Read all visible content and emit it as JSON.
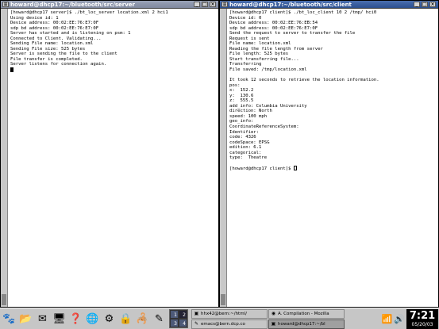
{
  "left_terminal": {
    "title": "howard@dhcp17:~/bluetooth/src/server",
    "lines": [
      "[howard@dhcp17 server]$ ./bt_loc_server location.xml 2 hci1",
      "Using device id: 1",
      "Device address: 00:02:EE:76:E7:0F",
      "sdp bd address: 00:02:EE:76:E7:0F",
      "Server has started and is listening on psm: 1",
      "Connected to Client. Validating...",
      "Sending File name: location.xml",
      "Sending File size: 525 bytes",
      "Server is sending the file to the client",
      "File transfer is completed.",
      "Server listens for connection again."
    ]
  },
  "right_terminal": {
    "title": "howard@dhcp17:~/bluetooth/src/client",
    "lines": [
      "[howard@dhcp17 client]$ ./bt_loc_client 10 2 /tmp/ hci0",
      "Device id: 0",
      "Device address: 00:02:EE:76:EB:54",
      "sdp bd address: 00:02:EE:76:E7:0F",
      "Send the request to server to transfer the file",
      "Request is sent",
      "File name: location.xml",
      "Reading the file length from server",
      "File length: 525 bytes",
      "Start transferring file...",
      "Transferring",
      "File saved: /tmp/location.xml",
      "",
      "It took 12 seconds to retrieve the location information.",
      "pos:",
      "x:  152.2",
      "y:  130.6",
      "z:  555.5",
      "add_info: Columbia University",
      "direction: North",
      "speed: 100 mph",
      "geo_info:",
      "CoordinateReferenceSystem:",
      "Identifier:",
      "code: 4326",
      "codeSpace: EPSG",
      "edition: 6.1",
      "categorical:",
      "type:  Theatre",
      "",
      "[howard@dhcp17 client]$ "
    ]
  },
  "taskbar": {
    "pager": [
      "1",
      "2",
      "3",
      "4"
    ],
    "tasks": [
      {
        "label": "hhx42@bern:~/html/",
        "icon": "terminal-icon"
      },
      {
        "label": "A. Compilation - Mozilla",
        "icon": "mozilla-icon"
      },
      {
        "label": "emacs@bern.dcp.co",
        "icon": "emacs-icon"
      },
      {
        "label": "howard@dhcp17:~/bl",
        "icon": "terminal-icon"
      }
    ],
    "clock_time": "7:21",
    "clock_date": "05/20/03"
  },
  "colors": {
    "active_title": "#2b4f8e",
    "inactive_title": "#7f889e",
    "desktop": "#5a6e8c"
  }
}
